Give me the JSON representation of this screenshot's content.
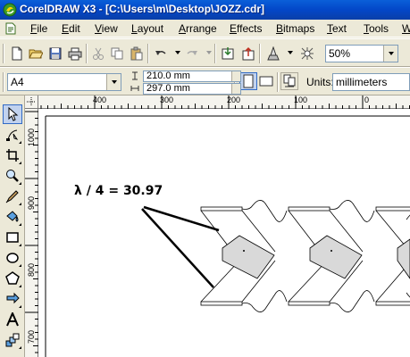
{
  "window": {
    "title": "CorelDRAW X3 - [C:\\Users\\m\\Desktop\\JOZZ.cdr]"
  },
  "menu": {
    "items": [
      {
        "label": "File"
      },
      {
        "label": "Edit"
      },
      {
        "label": "View"
      },
      {
        "label": "Layout"
      },
      {
        "label": "Arrange"
      },
      {
        "label": "Effects"
      },
      {
        "label": "Bitmaps"
      },
      {
        "label": "Text"
      },
      {
        "label": "Tools"
      },
      {
        "label": "W"
      }
    ]
  },
  "standard_toolbar": {
    "zoom_level": "50%"
  },
  "property_bar": {
    "paper_type": "A4",
    "width": "210.0 mm",
    "height": "297.0 mm",
    "units_label": "Units:",
    "units_value": "millimeters"
  },
  "rulers": {
    "horizontal_labels": [
      "400",
      "300",
      "200",
      "100",
      "0"
    ],
    "vertical_labels": [
      "1000",
      "900",
      "800",
      "700"
    ]
  },
  "canvas": {
    "annotation": "λ / 4 = 30.97"
  },
  "colors": {
    "titlebar": "#0347c8",
    "shape_fill": "#d9d9d9",
    "accent": "#316ac5"
  },
  "toolbox": {
    "tools": [
      "pick-tool-icon",
      "shape-tool-icon",
      "crop-tool-icon",
      "zoom-tool-icon",
      "freehand-tool-icon",
      "smart-fill-tool-icon",
      "rectangle-tool-icon",
      "ellipse-tool-icon",
      "polygon-tool-icon",
      "basic-shapes-tool-icon",
      "text-tool-icon",
      "interactive-blend-tool-icon"
    ]
  }
}
